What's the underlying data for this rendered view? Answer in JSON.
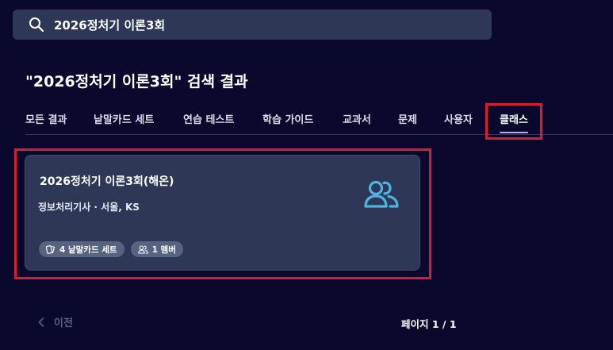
{
  "search": {
    "value": "2026정처기 이론3회"
  },
  "page_title": "\"2026정처기 이론3회\" 검색 결과",
  "tabs": [
    {
      "label": "모든 결과",
      "active": false
    },
    {
      "label": "낱말카드 세트",
      "active": false
    },
    {
      "label": "연습 테스트",
      "active": false
    },
    {
      "label": "학습 가이드",
      "active": false
    },
    {
      "label": "교과서",
      "active": false
    },
    {
      "label": "문제",
      "active": false
    },
    {
      "label": "사용자",
      "active": false
    },
    {
      "label": "클래스",
      "active": true
    }
  ],
  "class_card": {
    "name": "2026정처기 이론3회(해온)",
    "meta": "정보처리기사 · 서울, KS",
    "icon": "users-icon",
    "badges": [
      {
        "icon": "flashcards-icon",
        "label": "4 낱말카드 세트"
      },
      {
        "icon": "member-icon",
        "label": "1 멤버"
      }
    ]
  },
  "pagination": {
    "prev_label": "이전",
    "page_label": "페이지 1 / 1"
  },
  "colors": {
    "background": "#0a092d",
    "surface": "#2e3856",
    "accent": "#a8b1ff",
    "icon_blue": "#4fb3e3",
    "highlight_red": "#d81e2c"
  }
}
